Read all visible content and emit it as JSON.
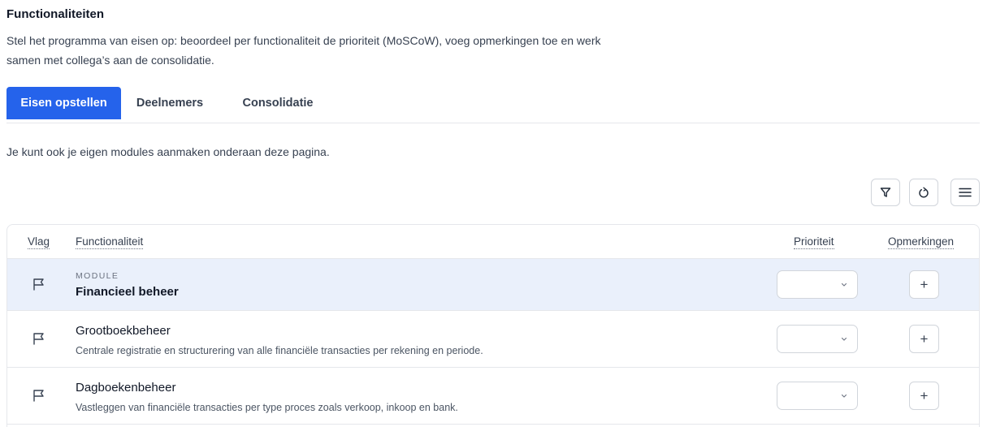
{
  "header": {
    "title": "Functionaliteiten",
    "intro": "Stel het programma van eisen op: beoordeel per functionaliteit de prioriteit (MoSCoW), voeg opmerkingen toe en werk samen met collega’s aan de consolidatie."
  },
  "tabs": [
    {
      "label": "Eisen opstellen",
      "active": true
    },
    {
      "label": "Deelnemers",
      "active": false
    },
    {
      "label": "Consolidatie",
      "active": false
    }
  ],
  "hint": "Je kunt ook je eigen modules aanmaken onderaan deze pagina.",
  "toolbar": {
    "icons": [
      "filter-icon",
      "reset-icon",
      "menu-icon"
    ]
  },
  "table": {
    "columns": {
      "flag": "Vlag",
      "functionality": "Functionaliteit",
      "priority": "Prioriteit",
      "remarks": "Opmerkingen"
    },
    "module": {
      "tag": "MODULE",
      "name": "Financieel beheer",
      "priority": ""
    },
    "rows": [
      {
        "name": "Grootboekbeheer",
        "description": "Centrale registratie en structurering van alle financiële transacties per rekening en periode.",
        "priority": ""
      },
      {
        "name": "Dagboekenbeheer",
        "description": "Vastleggen van financiële transacties per type proces zoals verkoop, inkoop en bank.",
        "priority": ""
      }
    ],
    "add_label": "+"
  },
  "colors": {
    "accent": "#2563eb",
    "module_row_bg": "#eaf0fb",
    "border": "#e5e7eb"
  }
}
